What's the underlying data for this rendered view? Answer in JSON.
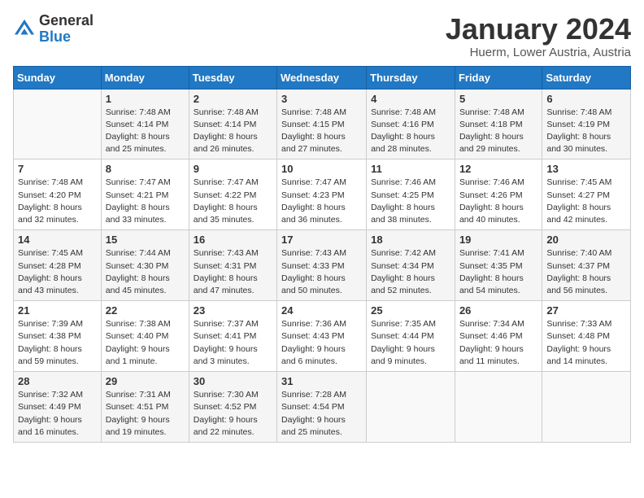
{
  "logo": {
    "general": "General",
    "blue": "Blue"
  },
  "title": "January 2024",
  "subtitle": "Huerm, Lower Austria, Austria",
  "weekdays": [
    "Sunday",
    "Monday",
    "Tuesday",
    "Wednesday",
    "Thursday",
    "Friday",
    "Saturday"
  ],
  "weeks": [
    [
      {
        "day": "",
        "sunrise": "",
        "sunset": "",
        "daylight": ""
      },
      {
        "day": "1",
        "sunrise": "Sunrise: 7:48 AM",
        "sunset": "Sunset: 4:14 PM",
        "daylight": "Daylight: 8 hours and 25 minutes."
      },
      {
        "day": "2",
        "sunrise": "Sunrise: 7:48 AM",
        "sunset": "Sunset: 4:14 PM",
        "daylight": "Daylight: 8 hours and 26 minutes."
      },
      {
        "day": "3",
        "sunrise": "Sunrise: 7:48 AM",
        "sunset": "Sunset: 4:15 PM",
        "daylight": "Daylight: 8 hours and 27 minutes."
      },
      {
        "day": "4",
        "sunrise": "Sunrise: 7:48 AM",
        "sunset": "Sunset: 4:16 PM",
        "daylight": "Daylight: 8 hours and 28 minutes."
      },
      {
        "day": "5",
        "sunrise": "Sunrise: 7:48 AM",
        "sunset": "Sunset: 4:18 PM",
        "daylight": "Daylight: 8 hours and 29 minutes."
      },
      {
        "day": "6",
        "sunrise": "Sunrise: 7:48 AM",
        "sunset": "Sunset: 4:19 PM",
        "daylight": "Daylight: 8 hours and 30 minutes."
      }
    ],
    [
      {
        "day": "7",
        "sunrise": "Sunrise: 7:48 AM",
        "sunset": "Sunset: 4:20 PM",
        "daylight": "Daylight: 8 hours and 32 minutes."
      },
      {
        "day": "8",
        "sunrise": "Sunrise: 7:47 AM",
        "sunset": "Sunset: 4:21 PM",
        "daylight": "Daylight: 8 hours and 33 minutes."
      },
      {
        "day": "9",
        "sunrise": "Sunrise: 7:47 AM",
        "sunset": "Sunset: 4:22 PM",
        "daylight": "Daylight: 8 hours and 35 minutes."
      },
      {
        "day": "10",
        "sunrise": "Sunrise: 7:47 AM",
        "sunset": "Sunset: 4:23 PM",
        "daylight": "Daylight: 8 hours and 36 minutes."
      },
      {
        "day": "11",
        "sunrise": "Sunrise: 7:46 AM",
        "sunset": "Sunset: 4:25 PM",
        "daylight": "Daylight: 8 hours and 38 minutes."
      },
      {
        "day": "12",
        "sunrise": "Sunrise: 7:46 AM",
        "sunset": "Sunset: 4:26 PM",
        "daylight": "Daylight: 8 hours and 40 minutes."
      },
      {
        "day": "13",
        "sunrise": "Sunrise: 7:45 AM",
        "sunset": "Sunset: 4:27 PM",
        "daylight": "Daylight: 8 hours and 42 minutes."
      }
    ],
    [
      {
        "day": "14",
        "sunrise": "Sunrise: 7:45 AM",
        "sunset": "Sunset: 4:28 PM",
        "daylight": "Daylight: 8 hours and 43 minutes."
      },
      {
        "day": "15",
        "sunrise": "Sunrise: 7:44 AM",
        "sunset": "Sunset: 4:30 PM",
        "daylight": "Daylight: 8 hours and 45 minutes."
      },
      {
        "day": "16",
        "sunrise": "Sunrise: 7:43 AM",
        "sunset": "Sunset: 4:31 PM",
        "daylight": "Daylight: 8 hours and 47 minutes."
      },
      {
        "day": "17",
        "sunrise": "Sunrise: 7:43 AM",
        "sunset": "Sunset: 4:33 PM",
        "daylight": "Daylight: 8 hours and 50 minutes."
      },
      {
        "day": "18",
        "sunrise": "Sunrise: 7:42 AM",
        "sunset": "Sunset: 4:34 PM",
        "daylight": "Daylight: 8 hours and 52 minutes."
      },
      {
        "day": "19",
        "sunrise": "Sunrise: 7:41 AM",
        "sunset": "Sunset: 4:35 PM",
        "daylight": "Daylight: 8 hours and 54 minutes."
      },
      {
        "day": "20",
        "sunrise": "Sunrise: 7:40 AM",
        "sunset": "Sunset: 4:37 PM",
        "daylight": "Daylight: 8 hours and 56 minutes."
      }
    ],
    [
      {
        "day": "21",
        "sunrise": "Sunrise: 7:39 AM",
        "sunset": "Sunset: 4:38 PM",
        "daylight": "Daylight: 8 hours and 59 minutes."
      },
      {
        "day": "22",
        "sunrise": "Sunrise: 7:38 AM",
        "sunset": "Sunset: 4:40 PM",
        "daylight": "Daylight: 9 hours and 1 minute."
      },
      {
        "day": "23",
        "sunrise": "Sunrise: 7:37 AM",
        "sunset": "Sunset: 4:41 PM",
        "daylight": "Daylight: 9 hours and 3 minutes."
      },
      {
        "day": "24",
        "sunrise": "Sunrise: 7:36 AM",
        "sunset": "Sunset: 4:43 PM",
        "daylight": "Daylight: 9 hours and 6 minutes."
      },
      {
        "day": "25",
        "sunrise": "Sunrise: 7:35 AM",
        "sunset": "Sunset: 4:44 PM",
        "daylight": "Daylight: 9 hours and 9 minutes."
      },
      {
        "day": "26",
        "sunrise": "Sunrise: 7:34 AM",
        "sunset": "Sunset: 4:46 PM",
        "daylight": "Daylight: 9 hours and 11 minutes."
      },
      {
        "day": "27",
        "sunrise": "Sunrise: 7:33 AM",
        "sunset": "Sunset: 4:48 PM",
        "daylight": "Daylight: 9 hours and 14 minutes."
      }
    ],
    [
      {
        "day": "28",
        "sunrise": "Sunrise: 7:32 AM",
        "sunset": "Sunset: 4:49 PM",
        "daylight": "Daylight: 9 hours and 16 minutes."
      },
      {
        "day": "29",
        "sunrise": "Sunrise: 7:31 AM",
        "sunset": "Sunset: 4:51 PM",
        "daylight": "Daylight: 9 hours and 19 minutes."
      },
      {
        "day": "30",
        "sunrise": "Sunrise: 7:30 AM",
        "sunset": "Sunset: 4:52 PM",
        "daylight": "Daylight: 9 hours and 22 minutes."
      },
      {
        "day": "31",
        "sunrise": "Sunrise: 7:28 AM",
        "sunset": "Sunset: 4:54 PM",
        "daylight": "Daylight: 9 hours and 25 minutes."
      },
      {
        "day": "",
        "sunrise": "",
        "sunset": "",
        "daylight": ""
      },
      {
        "day": "",
        "sunrise": "",
        "sunset": "",
        "daylight": ""
      },
      {
        "day": "",
        "sunrise": "",
        "sunset": "",
        "daylight": ""
      }
    ]
  ]
}
